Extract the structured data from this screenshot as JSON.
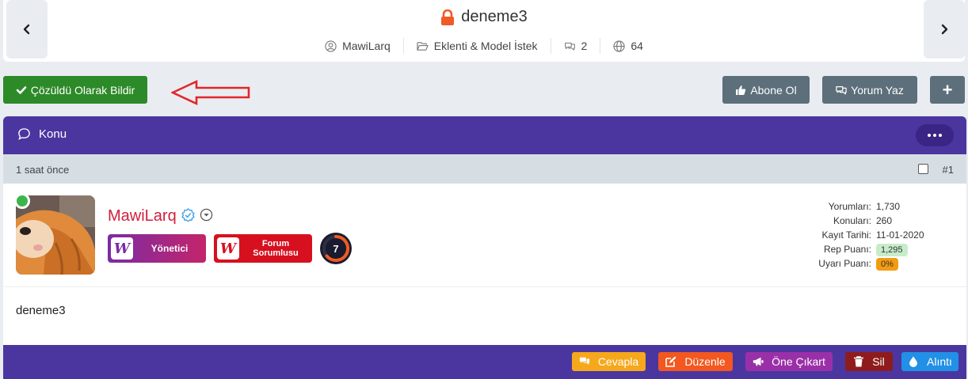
{
  "header": {
    "title": "deneme3",
    "meta": {
      "author": "MawiLarq",
      "category": "Eklenti & Model İstek",
      "replies": "2",
      "views": "64"
    }
  },
  "actions": {
    "resolve_label": "Çözüldü Olarak Bildir",
    "subscribe_label": "Abone Ol",
    "reply_label": "Yorum Yaz",
    "plus_label": "+"
  },
  "post": {
    "section_label": "Konu",
    "time": "1 saat önce",
    "number": "#1",
    "username": "MawiLarq",
    "badges": {
      "admin": "Yönetici",
      "forum_line1": "Forum",
      "forum_line2": "Sorumlusu",
      "level": "7"
    },
    "stats": [
      {
        "label": "Yorumları:",
        "value": "1,730"
      },
      {
        "label": "Konuları:",
        "value": "260"
      },
      {
        "label": "Kayıt Tarihi:",
        "value": "11-01-2020"
      },
      {
        "label": "Rep Puanı:",
        "value": "1,295"
      },
      {
        "label": "Uyarı Puanı:",
        "value": "0%"
      }
    ],
    "content": "deneme3"
  },
  "footer": {
    "reply": "Cevapla",
    "edit": "Düzenle",
    "feature": "Öne Çıkart",
    "delete": "Sil",
    "quote": "Alıntı"
  },
  "colors": {
    "accent_purple": "#4b36a0",
    "resolve_green": "#2d8a28",
    "username_red": "#d21f3c",
    "lock_orange": "#f05a28"
  }
}
